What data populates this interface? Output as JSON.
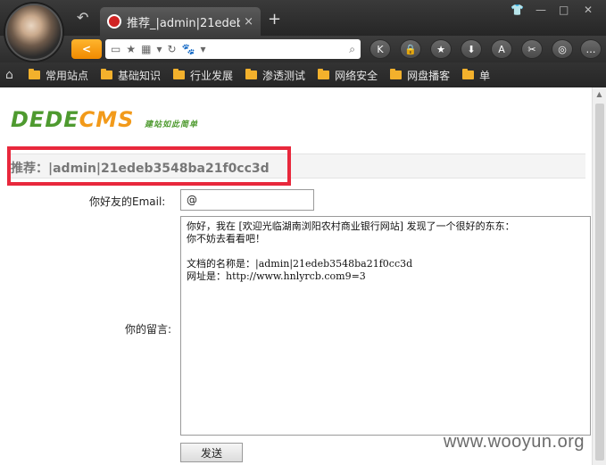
{
  "browser": {
    "tab_title": "推荐_|admin|21edeb",
    "tab_close": "×",
    "new_tab": "+",
    "back_label": "<",
    "window_controls": [
      "👕",
      "—",
      "□",
      "✕"
    ],
    "toolbar_buttons": [
      "K",
      "🔒",
      "★",
      "⬇",
      "A",
      "✂",
      "◎",
      "…"
    ]
  },
  "bookmarks": [
    "常用站点",
    "基础知识",
    "行业发展",
    "渗透测试",
    "网络安全",
    "网盘播客",
    "单"
  ],
  "page": {
    "logo_dede": "DEDE",
    "logo_cms": "CMS",
    "logo_slogan": "建站如此简单",
    "title": "推荐：|admin|21edeb3548ba21f0cc3d",
    "email_label": "你好友的Email:",
    "email_value": "@",
    "message_label": "你的留言:",
    "message_text": "你好，我在 [欢迎光临湖南浏阳农村商业银行网站] 发现了一个很好的东东：\n你不妨去看看吧！\n\n文档的名称是：|admin|21edeb3548ba21f0cc3d\n网址是：http://www.hnlyrcb.com9=3",
    "send_label": "发送",
    "watermark": "www.wooyun.org"
  },
  "colors": {
    "highlight_border": "#e8283c",
    "logo_green": "#4e9a2f",
    "logo_orange": "#f29a1a",
    "back_button": "#f08a00"
  }
}
